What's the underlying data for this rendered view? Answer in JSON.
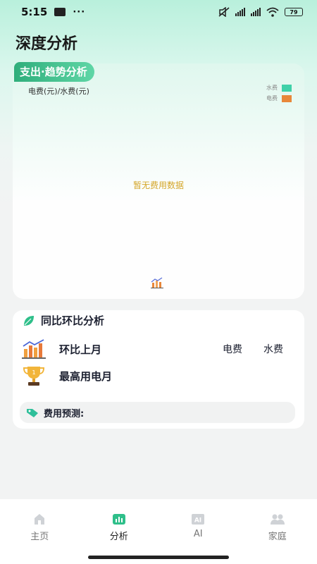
{
  "status_bar": {
    "time": "5:15",
    "more": "···",
    "battery": "79"
  },
  "page_title": "深度分析",
  "trend_card": {
    "tag": "支出·趋势分析",
    "axis_label": "电费(元)/水费(元)",
    "legend": [
      {
        "name": "水费",
        "color": "#3fd1a8"
      },
      {
        "name": "电费",
        "color": "#e8873a"
      }
    ],
    "empty_text": "暂无费用数据",
    "chart_icon": "bar-chart-icon"
  },
  "compare_card": {
    "title": "同比环比分析",
    "mom_label": "环比上月",
    "col_electric": "电费",
    "col_water": "水费",
    "max_label": "最高用电月",
    "forecast_label": "费用预测:"
  },
  "tabs": [
    {
      "label": "主页",
      "icon": "home-icon",
      "active": false
    },
    {
      "label": "分析",
      "icon": "analysis-icon",
      "active": true
    },
    {
      "label": "AI",
      "icon": "ai-icon",
      "active": false
    },
    {
      "label": "家庭",
      "icon": "family-icon",
      "active": false
    }
  ],
  "colors": {
    "accent": "#2fae7b",
    "empty_text": "#d4a62a"
  }
}
